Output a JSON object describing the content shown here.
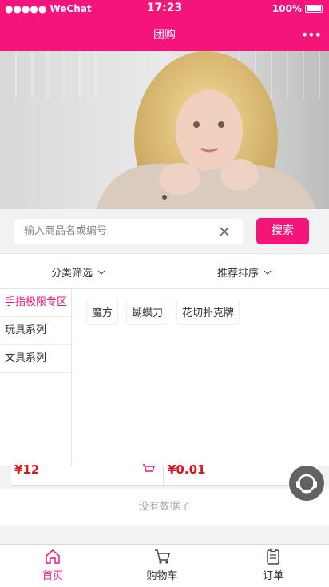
{
  "status_bar": {
    "carrier": "●●●●● WeChat",
    "time": "17:23",
    "battery": "100%"
  },
  "nav": {
    "title": "团购",
    "more": "•••"
  },
  "search": {
    "placeholder": "输入商品名或编号",
    "button": "搜索"
  },
  "filters": {
    "category": "分类筛选",
    "sort": "推荐排序"
  },
  "categories": [
    "手指极限专区",
    "玩具系列",
    "文具系列"
  ],
  "tags": [
    "魔方",
    "蝴蝶刀",
    "花切扑克牌"
  ],
  "products": {
    "price1": "¥12",
    "price2": "¥0.01"
  },
  "no_data": "没有数据了",
  "tabs": [
    "首页",
    "购物车",
    "订单"
  ],
  "colors": {
    "accent": "#f5157a",
    "price": "#e21318"
  }
}
